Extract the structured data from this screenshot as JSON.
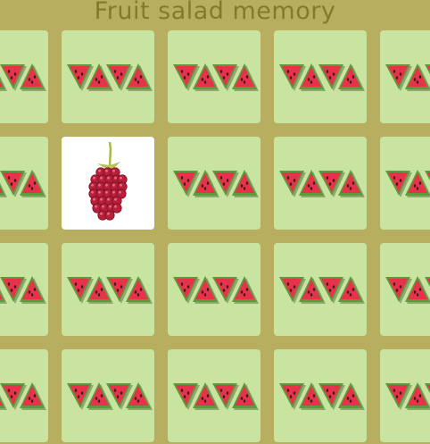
{
  "game": {
    "title": "Fruit salad memory"
  },
  "colors": {
    "background": "#b8ae60",
    "title": "#837b2b",
    "card_back": "#c9e3a0",
    "card_face": "#ffffff"
  },
  "board": {
    "rows": 4,
    "columns": 5,
    "card_back_icon": "watermelon-slices-icon",
    "cards": [
      {
        "state": "face-down"
      },
      {
        "state": "face-down"
      },
      {
        "state": "face-down"
      },
      {
        "state": "face-down"
      },
      {
        "state": "face-down"
      },
      {
        "state": "face-down"
      },
      {
        "state": "face-up",
        "fruit": "raspberry",
        "icon": "raspberry-icon"
      },
      {
        "state": "face-down"
      },
      {
        "state": "face-down"
      },
      {
        "state": "face-down"
      },
      {
        "state": "face-down"
      },
      {
        "state": "face-down"
      },
      {
        "state": "face-down"
      },
      {
        "state": "face-down"
      },
      {
        "state": "face-down"
      },
      {
        "state": "face-down"
      },
      {
        "state": "face-down"
      },
      {
        "state": "face-down"
      },
      {
        "state": "face-down"
      },
      {
        "state": "face-down"
      }
    ]
  }
}
